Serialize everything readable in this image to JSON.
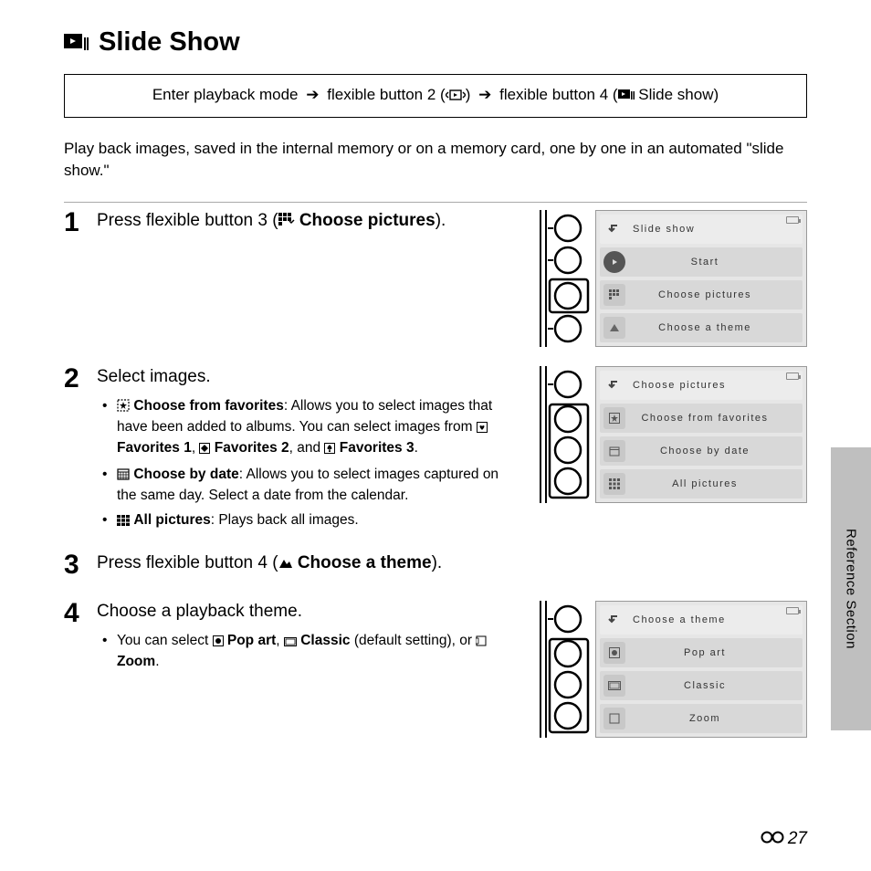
{
  "title": "Slide Show",
  "instruction": {
    "prefix": "Enter playback mode",
    "mid1": "flexible button 2 (",
    "mid2": ")",
    "mid3": "flexible button 4 (",
    "suffix": " Slide show)"
  },
  "intro": "Play back images, saved in the internal memory or on a memory card, one by one in an automated \"slide show.\"",
  "steps": {
    "s1": {
      "num": "1",
      "text_a": "Press flexible button 3 (",
      "text_b": " Choose pictures",
      "text_c": ")."
    },
    "s2": {
      "num": "2",
      "text": "Select images.",
      "b1_label": "Choose from favorites",
      "b1_text_a": ": Allows you to select images that have been added to albums. You can select images from ",
      "b1_fav1": "Favorites 1",
      "b1_sep1": ", ",
      "b1_fav2": "Favorites 2",
      "b1_sep2": ", and ",
      "b1_fav3": "Favorites 3",
      "b1_end": ".",
      "b2_label": "Choose by date",
      "b2_text": ": Allows you to select images captured on the same day. Select a date from the calendar.",
      "b3_label": "All pictures",
      "b3_text": ": Plays back all images."
    },
    "s3": {
      "num": "3",
      "text_a": "Press flexible button 4 (",
      "text_b": " Choose a theme",
      "text_c": ")."
    },
    "s4": {
      "num": "4",
      "text": "Choose a playback theme.",
      "bullet_a": "You can select ",
      "popart": "Pop art",
      "sep1": ", ",
      "classic": "Classic",
      "default": " (default setting), or ",
      "zoom": "Zoom",
      "end": "."
    }
  },
  "menus": {
    "m1": {
      "header": "Slide show",
      "r2": "Start",
      "r3": "Choose pictures",
      "r4": "Choose a theme"
    },
    "m2": {
      "header": "Choose pictures",
      "r2": "Choose from favorites",
      "r3": "Choose by date",
      "r4": "All pictures"
    },
    "m4": {
      "header": "Choose a theme",
      "r2": "Pop art",
      "r3": "Classic",
      "r4": "Zoom"
    }
  },
  "sideTab": "Reference Section",
  "pageNumber": "27"
}
